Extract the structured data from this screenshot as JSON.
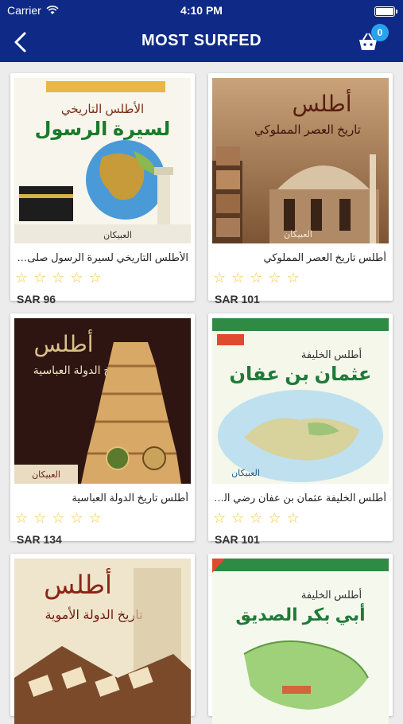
{
  "status_bar": {
    "carrier": "Carrier",
    "time": "4:10 PM"
  },
  "header": {
    "title": "MOST SURFED",
    "cart_count": "0"
  },
  "products": [
    {
      "name": "الأطلس التاريخي لسيرة الرسول صلى الله عليه وسلم",
      "price": "SAR 96",
      "cover": {
        "heading": "الأطلس التاريخي",
        "title": "لسيرة الرسول",
        "publisher": "العبيكان",
        "theme": "light"
      }
    },
    {
      "name": "أطلس تاريخ العصر المملوكي",
      "price": "SAR 101",
      "cover": {
        "heading": "أطلس",
        "title": "تاريخ العصر المملوكي",
        "publisher": "العبيكان",
        "theme": "brown"
      }
    },
    {
      "name": "أطلس تاريخ الدولة العباسية",
      "price": "SAR 134",
      "cover": {
        "heading": "أطلس",
        "title": "تاريخ الدولة العباسية",
        "publisher": "العبيكان",
        "theme": "dark"
      }
    },
    {
      "name": "أطلس الخليفة عثمان بن عفان رضي الله عنه",
      "price": "SAR 101",
      "cover": {
        "heading": "أطلس الخليفة",
        "title": "عثمان بن عفان",
        "publisher": "العبيكان",
        "theme": "map"
      }
    },
    {
      "name": "أطلس تاريخ الدولة الأموية",
      "price": "",
      "cover": {
        "heading": "أطلس",
        "title": "تاريخ الدولة الأموية",
        "publisher": "",
        "theme": "cream"
      }
    },
    {
      "name": "أطلس الخليفة أبي بكر الصديق",
      "price": "",
      "cover": {
        "heading": "أطلس الخليفة",
        "title": "أبي بكر الصديق",
        "publisher": "",
        "theme": "green"
      }
    }
  ],
  "colors": {
    "header_bg": "#0e2a86",
    "badge": "#27a3ee",
    "star": "#f2c94c"
  }
}
